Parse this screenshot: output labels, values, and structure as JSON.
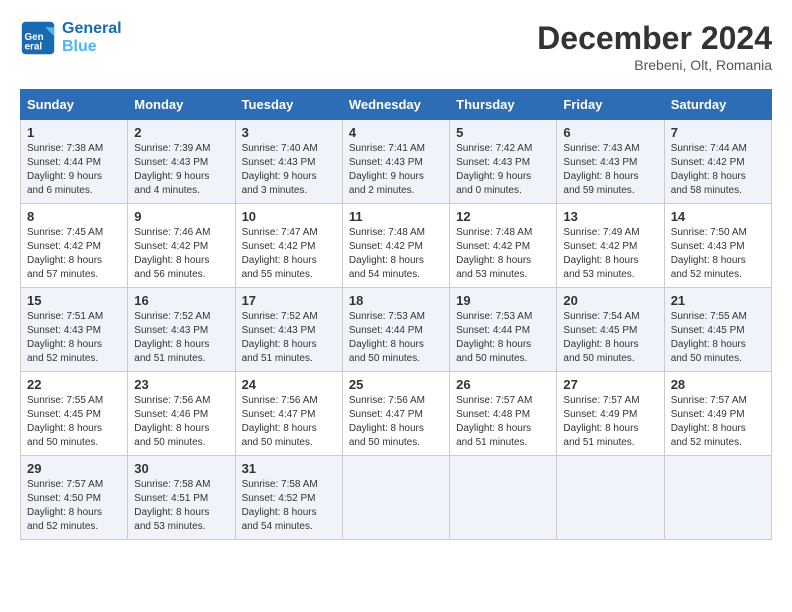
{
  "header": {
    "logo_line1": "General",
    "logo_line2": "Blue",
    "month": "December 2024",
    "location": "Brebeni, Olt, Romania"
  },
  "weekdays": [
    "Sunday",
    "Monday",
    "Tuesday",
    "Wednesday",
    "Thursday",
    "Friday",
    "Saturday"
  ],
  "weeks": [
    [
      {
        "day": "1",
        "info": "Sunrise: 7:38 AM\nSunset: 4:44 PM\nDaylight: 9 hours\nand 6 minutes."
      },
      {
        "day": "2",
        "info": "Sunrise: 7:39 AM\nSunset: 4:43 PM\nDaylight: 9 hours\nand 4 minutes."
      },
      {
        "day": "3",
        "info": "Sunrise: 7:40 AM\nSunset: 4:43 PM\nDaylight: 9 hours\nand 3 minutes."
      },
      {
        "day": "4",
        "info": "Sunrise: 7:41 AM\nSunset: 4:43 PM\nDaylight: 9 hours\nand 2 minutes."
      },
      {
        "day": "5",
        "info": "Sunrise: 7:42 AM\nSunset: 4:43 PM\nDaylight: 9 hours\nand 0 minutes."
      },
      {
        "day": "6",
        "info": "Sunrise: 7:43 AM\nSunset: 4:43 PM\nDaylight: 8 hours\nand 59 minutes."
      },
      {
        "day": "7",
        "info": "Sunrise: 7:44 AM\nSunset: 4:42 PM\nDaylight: 8 hours\nand 58 minutes."
      }
    ],
    [
      {
        "day": "8",
        "info": "Sunrise: 7:45 AM\nSunset: 4:42 PM\nDaylight: 8 hours\nand 57 minutes."
      },
      {
        "day": "9",
        "info": "Sunrise: 7:46 AM\nSunset: 4:42 PM\nDaylight: 8 hours\nand 56 minutes."
      },
      {
        "day": "10",
        "info": "Sunrise: 7:47 AM\nSunset: 4:42 PM\nDaylight: 8 hours\nand 55 minutes."
      },
      {
        "day": "11",
        "info": "Sunrise: 7:48 AM\nSunset: 4:42 PM\nDaylight: 8 hours\nand 54 minutes."
      },
      {
        "day": "12",
        "info": "Sunrise: 7:48 AM\nSunset: 4:42 PM\nDaylight: 8 hours\nand 53 minutes."
      },
      {
        "day": "13",
        "info": "Sunrise: 7:49 AM\nSunset: 4:42 PM\nDaylight: 8 hours\nand 53 minutes."
      },
      {
        "day": "14",
        "info": "Sunrise: 7:50 AM\nSunset: 4:43 PM\nDaylight: 8 hours\nand 52 minutes."
      }
    ],
    [
      {
        "day": "15",
        "info": "Sunrise: 7:51 AM\nSunset: 4:43 PM\nDaylight: 8 hours\nand 52 minutes."
      },
      {
        "day": "16",
        "info": "Sunrise: 7:52 AM\nSunset: 4:43 PM\nDaylight: 8 hours\nand 51 minutes."
      },
      {
        "day": "17",
        "info": "Sunrise: 7:52 AM\nSunset: 4:43 PM\nDaylight: 8 hours\nand 51 minutes."
      },
      {
        "day": "18",
        "info": "Sunrise: 7:53 AM\nSunset: 4:44 PM\nDaylight: 8 hours\nand 50 minutes."
      },
      {
        "day": "19",
        "info": "Sunrise: 7:53 AM\nSunset: 4:44 PM\nDaylight: 8 hours\nand 50 minutes."
      },
      {
        "day": "20",
        "info": "Sunrise: 7:54 AM\nSunset: 4:45 PM\nDaylight: 8 hours\nand 50 minutes."
      },
      {
        "day": "21",
        "info": "Sunrise: 7:55 AM\nSunset: 4:45 PM\nDaylight: 8 hours\nand 50 minutes."
      }
    ],
    [
      {
        "day": "22",
        "info": "Sunrise: 7:55 AM\nSunset: 4:45 PM\nDaylight: 8 hours\nand 50 minutes."
      },
      {
        "day": "23",
        "info": "Sunrise: 7:56 AM\nSunset: 4:46 PM\nDaylight: 8 hours\nand 50 minutes."
      },
      {
        "day": "24",
        "info": "Sunrise: 7:56 AM\nSunset: 4:47 PM\nDaylight: 8 hours\nand 50 minutes."
      },
      {
        "day": "25",
        "info": "Sunrise: 7:56 AM\nSunset: 4:47 PM\nDaylight: 8 hours\nand 50 minutes."
      },
      {
        "day": "26",
        "info": "Sunrise: 7:57 AM\nSunset: 4:48 PM\nDaylight: 8 hours\nand 51 minutes."
      },
      {
        "day": "27",
        "info": "Sunrise: 7:57 AM\nSunset: 4:49 PM\nDaylight: 8 hours\nand 51 minutes."
      },
      {
        "day": "28",
        "info": "Sunrise: 7:57 AM\nSunset: 4:49 PM\nDaylight: 8 hours\nand 52 minutes."
      }
    ],
    [
      {
        "day": "29",
        "info": "Sunrise: 7:57 AM\nSunset: 4:50 PM\nDaylight: 8 hours\nand 52 minutes."
      },
      {
        "day": "30",
        "info": "Sunrise: 7:58 AM\nSunset: 4:51 PM\nDaylight: 8 hours\nand 53 minutes."
      },
      {
        "day": "31",
        "info": "Sunrise: 7:58 AM\nSunset: 4:52 PM\nDaylight: 8 hours\nand 54 minutes."
      },
      {
        "day": "",
        "info": ""
      },
      {
        "day": "",
        "info": ""
      },
      {
        "day": "",
        "info": ""
      },
      {
        "day": "",
        "info": ""
      }
    ]
  ]
}
